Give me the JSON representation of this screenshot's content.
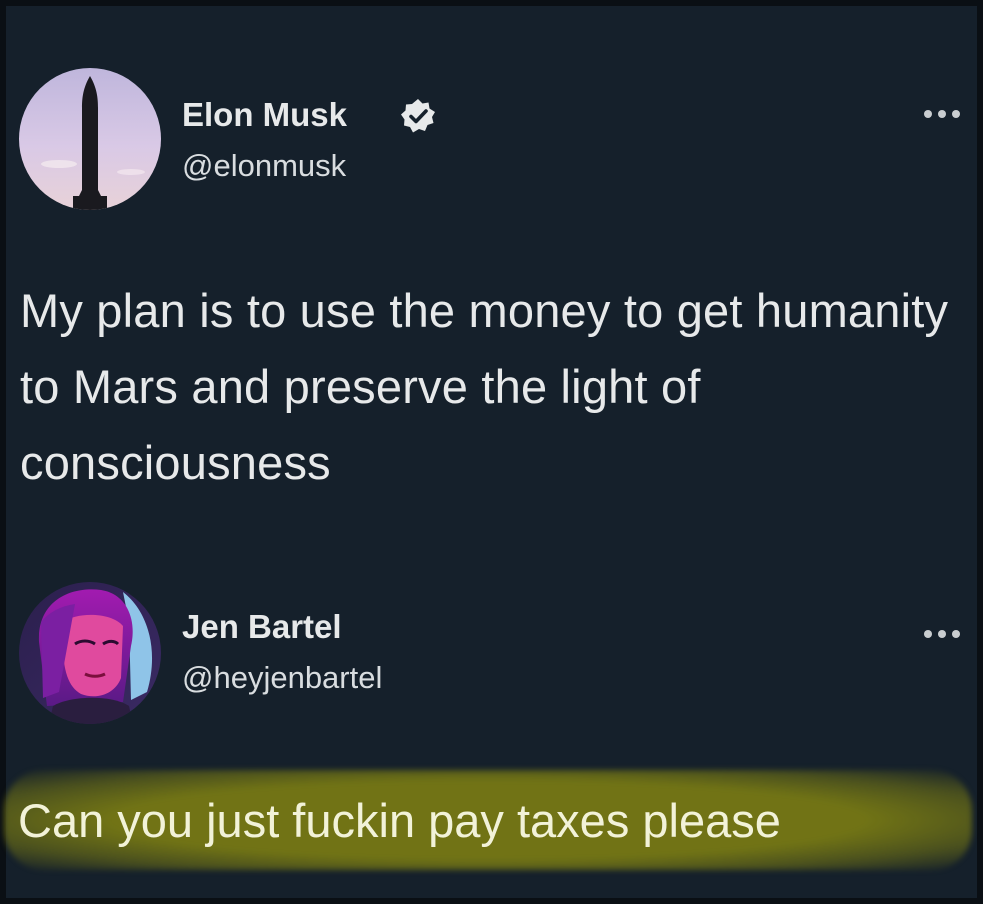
{
  "tweet": {
    "author": {
      "display_name": "Elon Musk",
      "handle": "@elonmusk",
      "verified_icon": "verified-badge-icon",
      "avatar_icon": "rocket-silhouette-avatar"
    },
    "more_icon": "more-options-icon",
    "text": "My plan is to use the money to get humanity to Mars and preserve the light of consciousness"
  },
  "reply": {
    "author": {
      "display_name": "Jen Bartel",
      "handle": "@heyjenbartel",
      "avatar_icon": "illustrated-portrait-avatar"
    },
    "more_icon": "more-options-icon",
    "text": "Can you just fuckin pay taxes please",
    "highlight_color": "#767814"
  },
  "colors": {
    "background": "#15202b",
    "primary_text": "#e7e9ea",
    "secondary_text": "#d9dde0",
    "verified": "#e7e9ea"
  }
}
